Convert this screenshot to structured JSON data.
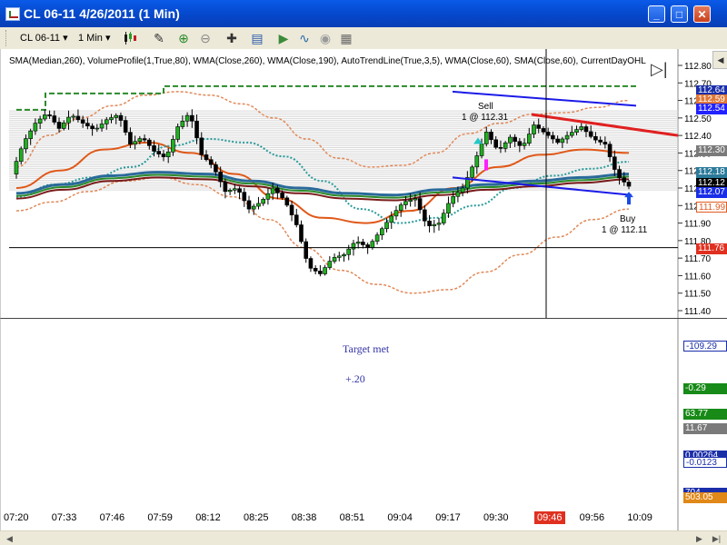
{
  "window": {
    "title": "CL 06-11  4/26/2011 (1 Min)",
    "minimize_icon": "minimize-icon",
    "maximize_icon": "maximize-icon",
    "close_icon": "close-icon"
  },
  "toolbar": {
    "instrument": "CL 06-11",
    "interval": "1 Min",
    "icons": [
      "candlestick-icon",
      "pencil-draw-icon",
      "zoom-in-icon",
      "zoom-out-icon",
      "crosshair-icon",
      "properties-icon",
      "strategy-icon",
      "indicators-icon",
      "settings-icon",
      "template-icon"
    ]
  },
  "indicators_label": "SMA(Median,260), VolumeProfile(1,True,80), WMA(Close,260), WMA(Close,190), AutoTrendLine(True,3,5), WMA(Close,60), SMA(Close,60), CurrentDayOHL",
  "annotations": {
    "sell_label": "Sell",
    "sell_detail": "1 @ 112.31",
    "buy_label": "Buy",
    "buy_detail": "1 @ 112.11",
    "target_text": "Target met",
    "profit_text": "+.20"
  },
  "price_scale": {
    "ticks": [
      "112.80",
      "112.70",
      "112.60",
      "112.50",
      "112.40",
      "112.30",
      "112.20",
      "112.10",
      "112.00",
      "111.90",
      "111.80",
      "111.70",
      "111.60",
      "111.50",
      "111.40"
    ],
    "boxes": [
      {
        "label": "112.64",
        "color": "#1a2ea8"
      },
      {
        "label": "112.59",
        "color": "#e07838"
      },
      {
        "label": "112.54",
        "color": "#2222ff"
      },
      {
        "label": "112.30",
        "color": "#7a7a7a"
      },
      {
        "label": "112.18",
        "color": "#2b7a9a"
      },
      {
        "label": "112.12",
        "color": "#000000"
      },
      {
        "label": "112.07",
        "color": "#1a2ee8"
      },
      {
        "label": "111.99",
        "color": "#e05a20"
      },
      {
        "label": "111.76",
        "color": "#e03020"
      }
    ]
  },
  "lower_panel_boxes": [
    {
      "label": "-109.29",
      "color": "#1a2ea8"
    },
    {
      "label": "-0.29",
      "color": "#188a18"
    },
    {
      "label": "63.77",
      "color": "#188a18"
    },
    {
      "label": "11.67",
      "color": "#7a7a7a"
    },
    {
      "label": "0.00264",
      "color": "#1a2ea8"
    },
    {
      "label": "-0.0123",
      "color": "#1a2ea8"
    },
    {
      "label": "704",
      "color": "#1a2ea8"
    },
    {
      "label": "503.05",
      "color": "#e08818"
    }
  ],
  "time_axis": [
    "07:20",
    "07:33",
    "07:46",
    "07:59",
    "08:12",
    "08:25",
    "08:38",
    "08:51",
    "09:04",
    "09:17",
    "09:30",
    "09:43",
    "09:56",
    "10:09"
  ],
  "crosshair_time": "09:46",
  "crosshair_price": "111.76",
  "chart_data": {
    "type": "candlestick",
    "title": "CL 06-11 4/26/2011 (1 Min)",
    "xlabel": "",
    "ylabel": "",
    "ylim": [
      111.4,
      112.8
    ],
    "x": [
      "07:20",
      "07:33",
      "07:46",
      "07:59",
      "08:12",
      "08:25",
      "08:38",
      "08:51",
      "09:04",
      "09:17",
      "09:30",
      "09:43",
      "09:56",
      "10:09"
    ],
    "close_path": [
      112.18,
      112.36,
      112.47,
      112.53,
      112.44,
      112.52,
      112.47,
      112.43,
      112.49,
      112.52,
      112.35,
      112.39,
      112.31,
      112.27,
      112.45,
      112.53,
      112.29,
      112.22,
      112.08,
      112.1,
      111.98,
      112.02,
      112.1,
      112.03,
      111.89,
      111.65,
      111.61,
      111.7,
      111.72,
      111.8,
      111.76,
      111.85,
      111.94,
      112.02,
      112.04,
      111.88,
      111.9,
      112.04,
      112.1,
      112.25,
      112.42,
      112.31,
      112.39,
      112.33,
      112.46,
      112.41,
      112.36,
      112.41,
      112.45,
      112.38,
      112.35,
      112.17,
      112.11
    ],
    "sma_median_260": [
      112.22,
      112.4,
      112.5,
      112.57,
      112.63,
      112.65,
      112.63,
      112.58,
      112.5,
      112.38,
      112.27,
      112.22,
      112.23,
      112.3,
      112.41,
      112.47,
      112.52,
      112.53,
      112.56,
      112.6
    ],
    "lower_band": [
      111.97,
      112.02,
      112.08,
      112.14,
      112.16,
      112.12,
      112.05,
      111.92,
      111.76,
      111.63,
      111.55,
      111.5,
      111.52,
      111.62,
      111.72,
      111.82,
      111.92,
      111.98
    ],
    "wma_close_60": [
      112.05,
      112.12,
      112.16,
      112.22,
      112.34,
      112.38,
      112.36,
      112.28,
      112.14,
      111.98,
      111.9,
      111.93,
      112.0,
      112.1,
      112.17,
      112.21,
      112.25
    ],
    "wma_close_190": [
      112.07,
      112.12,
      112.17,
      112.19,
      112.18,
      112.14,
      112.1,
      112.07,
      112.06,
      112.09,
      112.12,
      112.14,
      112.16,
      112.18
    ],
    "sma_close_60": [
      112.1,
      112.2,
      112.32,
      112.36,
      112.3,
      112.18,
      112.04,
      111.93,
      111.9,
      111.97,
      112.1,
      112.22,
      112.29,
      112.32,
      112.3
    ],
    "ohl_high": 112.64,
    "resistance_line": [
      112.65,
      112.57
    ],
    "downtrend_line": [
      112.52,
      112.4
    ],
    "support_line": [
      112.16,
      112.06
    ],
    "trades": [
      {
        "side": "Sell",
        "qty": 1,
        "price": 112.31
      },
      {
        "side": "Buy",
        "qty": 1,
        "price": 112.11
      }
    ]
  }
}
